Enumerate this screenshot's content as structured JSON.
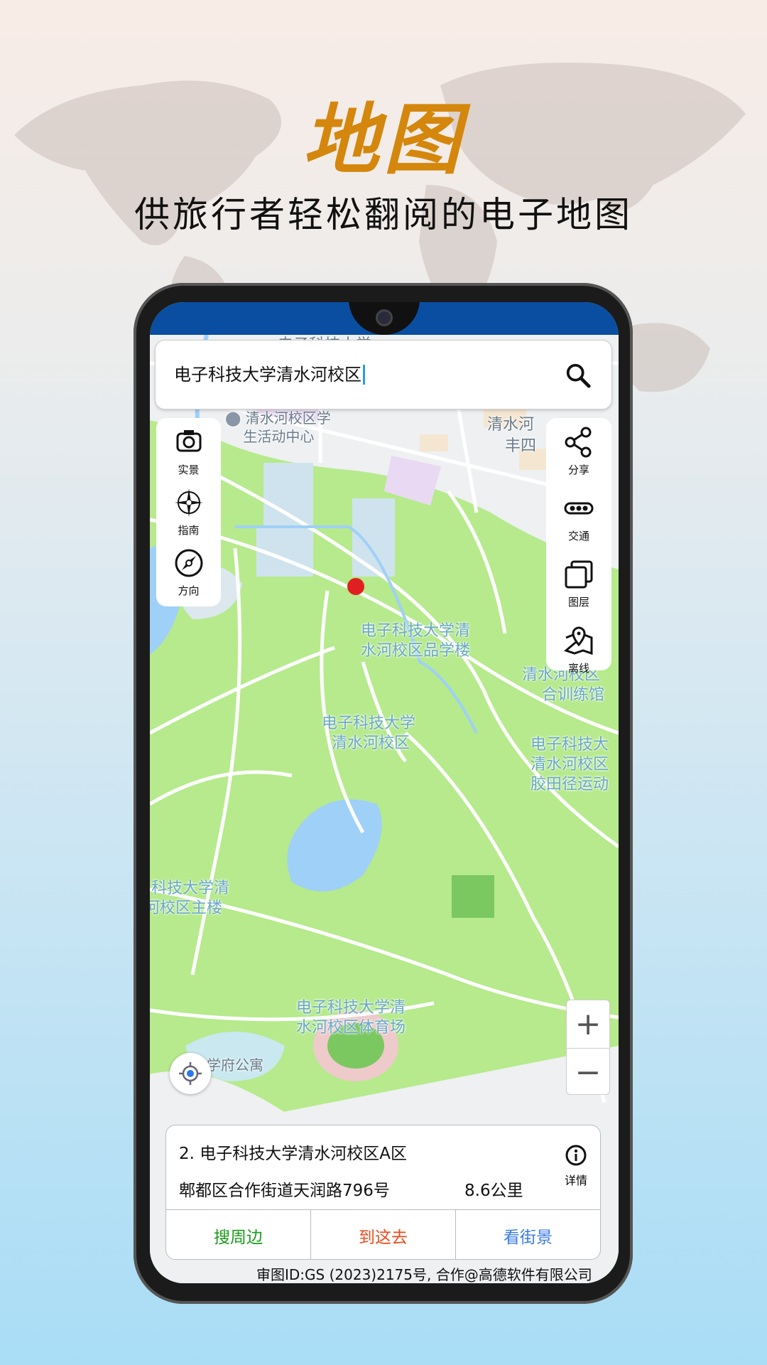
{
  "promo": {
    "title": "地图",
    "subtitle": "供旅行者轻松翻阅的电子地图"
  },
  "search": {
    "value": "电子科技大学清水河校区",
    "icon": "search-icon"
  },
  "left_tools": [
    {
      "label": "实景",
      "icon": "camera-icon"
    },
    {
      "label": "指南",
      "icon": "compass-rose-icon"
    },
    {
      "label": "方向",
      "icon": "direction-compass-icon"
    }
  ],
  "right_tools": [
    {
      "label": "分享",
      "icon": "share-icon"
    },
    {
      "label": "交通",
      "icon": "traffic-icon"
    },
    {
      "label": "图层",
      "icon": "layers-icon"
    },
    {
      "label": "离线",
      "icon": "offline-map-icon"
    }
  ],
  "zoom": {
    "in": "+",
    "out": "−"
  },
  "map_labels": [
    "电子科技大学",
    "电子科技大学",
    "清水河校区学",
    "生活动中心",
    "清水河",
    "丰四",
    "电子科技大学清",
    "水河校区品学楼",
    "电子科技大学",
    "清水河校区",
    "清水河校区",
    "合训练馆",
    "电子科技大",
    "清水河校区",
    "胶田径运动",
    "科技大学清",
    "河校区主楼",
    "电子科技大学清",
    "水河校区体育场",
    "学府公寓"
  ],
  "place_card": {
    "name": "2. 电子科技大学清水河校区A区",
    "address": "郫都区合作街道天润路796号",
    "distance": "8.6公里",
    "detail_label": "详情",
    "actions": [
      {
        "label": "搜周边",
        "color": "#1a9a1a"
      },
      {
        "label": "到这去",
        "color": "#f04a1a"
      },
      {
        "label": "看街景",
        "color": "#3a7ae8"
      }
    ]
  },
  "copyright": "审图ID:GS (2023)2175号, 合作@高德软件有限公司"
}
